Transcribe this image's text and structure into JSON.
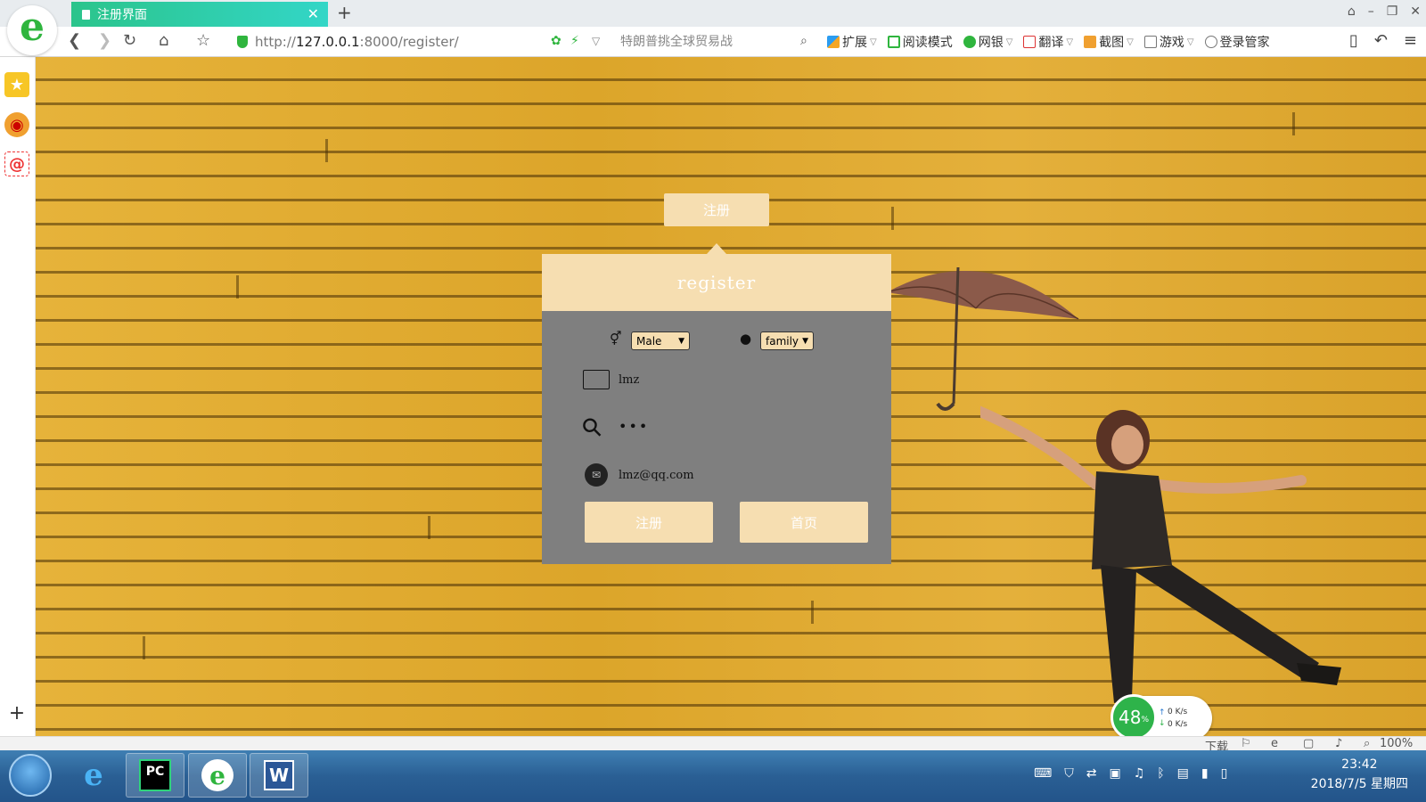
{
  "browser": {
    "tab_title": "注册界面",
    "tab_close": "✕",
    "new_tab": "+",
    "url_scheme": "http://",
    "url_host": "127.0.0.1",
    "url_path": ":8000/register/",
    "search_placeholder": "特朗普挑全球贸易战",
    "toolbar": {
      "extensions": "扩展",
      "reading_mode": "阅读模式",
      "bank": "网银",
      "translate": "翻译",
      "screenshot": "截图",
      "games": "游戏",
      "login_manager": "登录管家"
    },
    "colors": {
      "tab_start": "#2bc48b",
      "tab_end": "#33d6c7",
      "brand": "#2fb53e"
    }
  },
  "sidebar": {
    "items": [
      {
        "icon": "favorites-star-icon"
      },
      {
        "icon": "weibo-icon"
      },
      {
        "icon": "email-icon",
        "label": "@"
      }
    ],
    "add": "+"
  },
  "register": {
    "tab_label": "注册",
    "header": "register",
    "gender": {
      "selected": "Male",
      "arrow": "▼"
    },
    "role": {
      "selected": "family",
      "arrow": "▼"
    },
    "username": "lmz",
    "password": "•••",
    "email": "lmz@qq.com",
    "submit_label": "注册",
    "home_label": "首页",
    "colors": {
      "accent": "#f6deb1",
      "panel_bg": "#7f7f7f"
    }
  },
  "network": {
    "percent": "48",
    "percent_unit": "%",
    "upload": "0 K/s",
    "download": "0 K/s"
  },
  "statusbar": {
    "download": "下载",
    "zoom": "100%"
  },
  "taskbar": {
    "apps": [
      {
        "name": "internet-explorer-icon"
      },
      {
        "name": "pycharm-icon",
        "label": "PC"
      },
      {
        "name": "360-browser-icon",
        "label": "e"
      },
      {
        "name": "word-icon",
        "label": "W"
      }
    ],
    "time": "23:42",
    "date": "2018/7/5 星期四"
  }
}
